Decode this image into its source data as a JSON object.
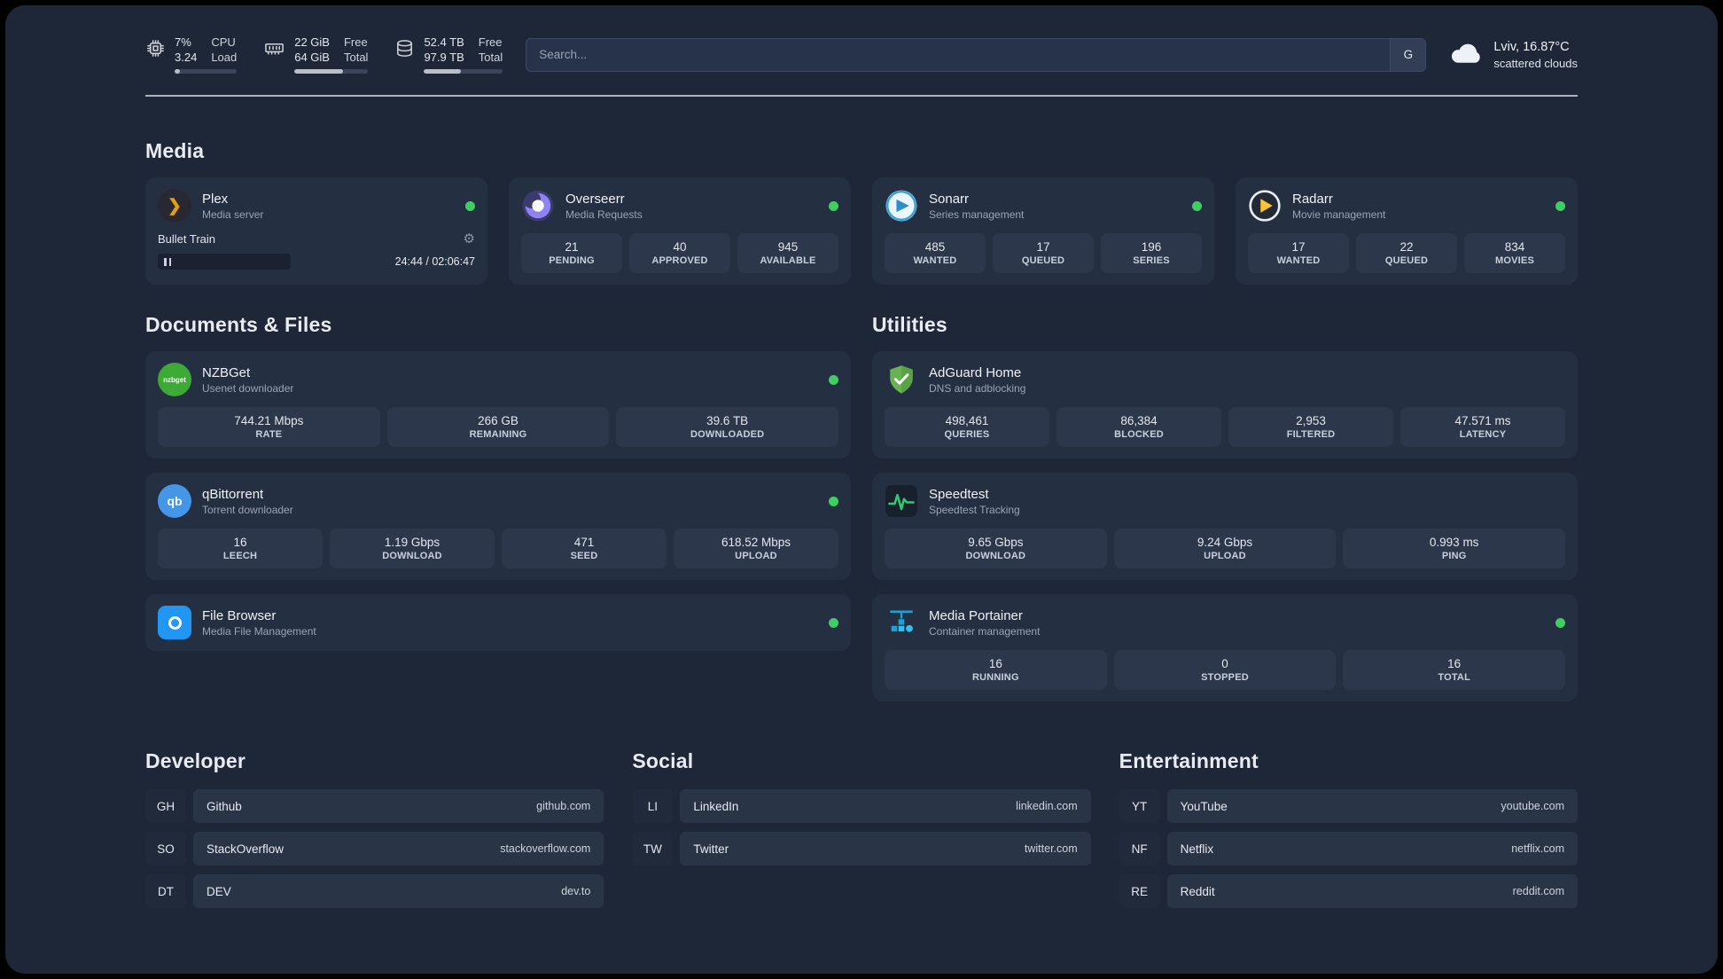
{
  "topbar": {
    "cpu": {
      "value_top": "7%",
      "value_bottom": "3.24",
      "label_top": "CPU",
      "label_bottom": "Load"
    },
    "ram": {
      "value_top": "22 GiB",
      "value_bottom": "64 GiB",
      "label_top": "Free",
      "label_bottom": "Total"
    },
    "disk": {
      "value_top": "52.4 TB",
      "value_bottom": "97.9 TB",
      "label_top": "Free",
      "label_bottom": "Total"
    },
    "search": {
      "placeholder": "Search...",
      "engine_label": "G"
    },
    "weather": {
      "location": "Lviv, 16.87°C",
      "condition": "scattered clouds"
    }
  },
  "sections": {
    "media": "Media",
    "documents": "Documents & Files",
    "utilities": "Utilities",
    "developer": "Developer",
    "social": "Social",
    "entertainment": "Entertainment"
  },
  "apps": {
    "plex": {
      "title": "Plex",
      "subtitle": "Media server",
      "now_playing": "Bullet Train",
      "time": "24:44 / 02:06:47",
      "icon_glyph": "❯"
    },
    "overseerr": {
      "title": "Overseerr",
      "subtitle": "Media Requests",
      "stats": [
        {
          "value": "21",
          "label": "PENDING"
        },
        {
          "value": "40",
          "label": "APPROVED"
        },
        {
          "value": "945",
          "label": "AVAILABLE"
        }
      ]
    },
    "sonarr": {
      "title": "Sonarr",
      "subtitle": "Series management",
      "stats": [
        {
          "value": "485",
          "label": "WANTED"
        },
        {
          "value": "17",
          "label": "QUEUED"
        },
        {
          "value": "196",
          "label": "SERIES"
        }
      ]
    },
    "radarr": {
      "title": "Radarr",
      "subtitle": "Movie management",
      "stats": [
        {
          "value": "17",
          "label": "WANTED"
        },
        {
          "value": "22",
          "label": "QUEUED"
        },
        {
          "value": "834",
          "label": "MOVIES"
        }
      ]
    },
    "nzbget": {
      "title": "NZBGet",
      "subtitle": "Usenet downloader",
      "icon_label": "nzbget",
      "stats": [
        {
          "value": "744.21 Mbps",
          "label": "RATE"
        },
        {
          "value": "266 GB",
          "label": "REMAINING"
        },
        {
          "value": "39.6 TB",
          "label": "DOWNLOADED"
        }
      ]
    },
    "qbittorrent": {
      "title": "qBittorrent",
      "subtitle": "Torrent downloader",
      "icon_label": "qb",
      "stats": [
        {
          "value": "16",
          "label": "LEECH"
        },
        {
          "value": "1.19 Gbps",
          "label": "DOWNLOAD"
        },
        {
          "value": "471",
          "label": "SEED"
        },
        {
          "value": "618.52 Mbps",
          "label": "UPLOAD"
        }
      ]
    },
    "filebrowser": {
      "title": "File Browser",
      "subtitle": "Media File Management"
    },
    "adguard": {
      "title": "AdGuard Home",
      "subtitle": "DNS and adblocking",
      "stats": [
        {
          "value": "498,461",
          "label": "QUERIES"
        },
        {
          "value": "86,384",
          "label": "BLOCKED"
        },
        {
          "value": "2,953",
          "label": "FILTERED"
        },
        {
          "value": "47.571 ms",
          "label": "LATENCY"
        }
      ]
    },
    "speedtest": {
      "title": "Speedtest",
      "subtitle": "Speedtest Tracking",
      "stats": [
        {
          "value": "9.65 Gbps",
          "label": "DOWNLOAD"
        },
        {
          "value": "9.24 Gbps",
          "label": "UPLOAD"
        },
        {
          "value": "0.993 ms",
          "label": "PING"
        }
      ]
    },
    "portainer": {
      "title": "Media Portainer",
      "subtitle": "Container management",
      "stats": [
        {
          "value": "16",
          "label": "RUNNING"
        },
        {
          "value": "0",
          "label": "STOPPED"
        },
        {
          "value": "16",
          "label": "TOTAL"
        }
      ]
    }
  },
  "bookmarks": {
    "developer": [
      {
        "abbr": "GH",
        "name": "Github",
        "url": "github.com"
      },
      {
        "abbr": "SO",
        "name": "StackOverflow",
        "url": "stackoverflow.com"
      },
      {
        "abbr": "DT",
        "name": "DEV",
        "url": "dev.to"
      }
    ],
    "social": [
      {
        "abbr": "LI",
        "name": "LinkedIn",
        "url": "linkedin.com"
      },
      {
        "abbr": "TW",
        "name": "Twitter",
        "url": "twitter.com"
      }
    ],
    "entertainment": [
      {
        "abbr": "YT",
        "name": "YouTube",
        "url": "youtube.com"
      },
      {
        "abbr": "NF",
        "name": "Netflix",
        "url": "netflix.com"
      },
      {
        "abbr": "RE",
        "name": "Reddit",
        "url": "reddit.com"
      }
    ]
  },
  "colors": {
    "status_green": "#3bd060",
    "plex_amber": "#e5a00d",
    "accent_bg": "#1d2737"
  }
}
